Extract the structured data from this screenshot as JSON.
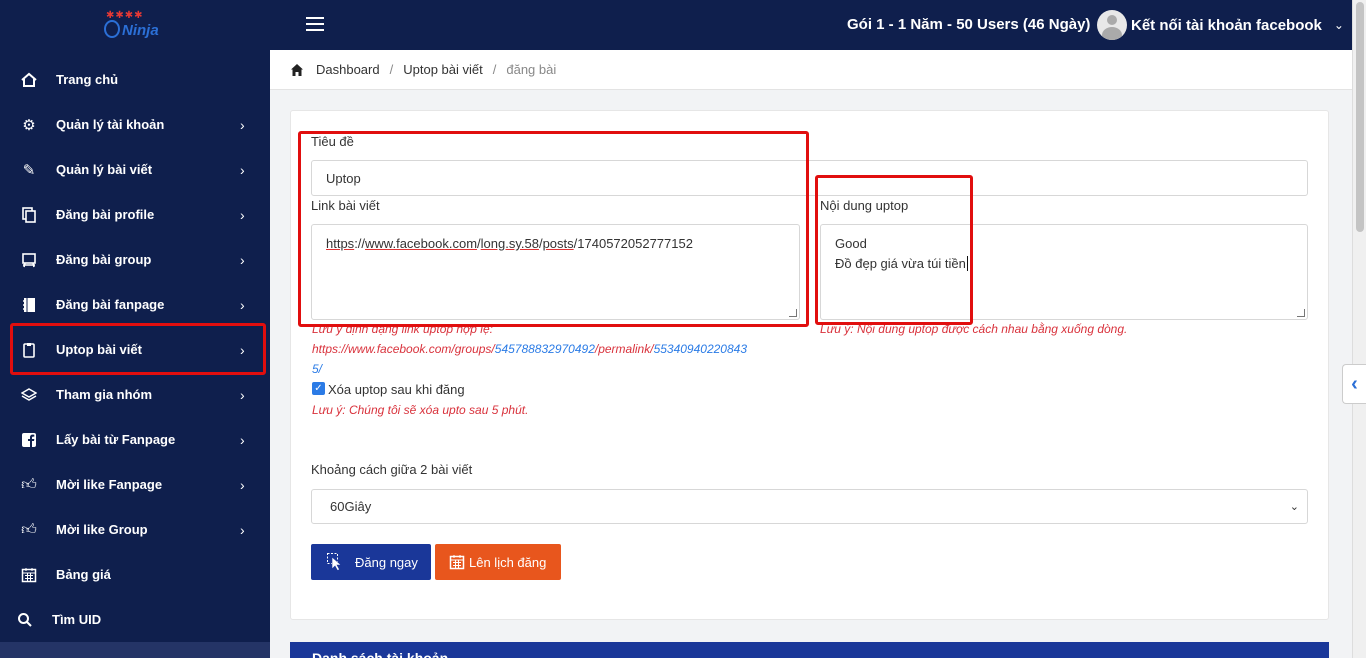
{
  "header": {
    "logo_text": "Ninja",
    "plan": "Gói 1 - 1 Năm - 50 Users (46 Ngày)",
    "user_label": "Kết nối tài khoản facebook"
  },
  "sidebar": {
    "items": [
      {
        "label": "Trang chủ",
        "icon": "home-icon"
      },
      {
        "label": "Quản lý tài khoản",
        "icon": "gear-icon"
      },
      {
        "label": "Quản lý bài viết",
        "icon": "pencil-icon"
      },
      {
        "label": "Đăng bài profile",
        "icon": "copy-icon"
      },
      {
        "label": "Đăng bài group",
        "icon": "board-icon"
      },
      {
        "label": "Đăng bài fanpage",
        "icon": "notebook-icon"
      },
      {
        "label": "Uptop bài viết",
        "icon": "clipboard-icon"
      },
      {
        "label": "Tham gia nhóm",
        "icon": "layers-icon"
      },
      {
        "label": "Lấy bài từ Fanpage",
        "icon": "facebook-icon"
      },
      {
        "label": "Mời like Fanpage",
        "icon": "thumbs-up-icon"
      },
      {
        "label": "Mời like Group",
        "icon": "thumbs-up-icon"
      },
      {
        "label": "Bảng giá",
        "icon": "calendar-icon"
      },
      {
        "label": "Tìm UID",
        "icon": "search-icon"
      }
    ]
  },
  "breadcrumb": {
    "items": [
      "Dashboard",
      "Uptop bài viết"
    ],
    "current": "đăng bài"
  },
  "form": {
    "title_label": "Tiêu đề",
    "title_value": "Uptop",
    "link_label": "Link bài viết",
    "link_parts": [
      "https",
      "://",
      "www.facebook.com",
      "/",
      "long.sy.58",
      "/",
      "posts",
      "/1740572052777152"
    ],
    "link_note_prefix": "Lưu ý định dạng link uptop hợp lệ:",
    "link_note_line1_base": "https://www.facebook.com/groups/",
    "link_note_line1_id": "545788832970492",
    "link_note_line1_mid": "/permalink/",
    "link_note_line1_tail": "55340940220843",
    "link_note_line2": "5/",
    "content_label": "Nội dung uptop",
    "content_lines": [
      "Good",
      "Đồ đẹp giá vừa túi tiền"
    ],
    "content_note": "Lưu ý: Nội dung uptop được cách nhau bằng xuống dòng.",
    "delete_checkbox_label": "Xóa uptop sau khi đăng",
    "delete_checked": true,
    "delete_note": "Lưu ý: Chúng tôi sẽ xóa upto sau 5 phút.",
    "interval_label": "Khoảng cách giữa 2 bài viết",
    "interval_value": "60Giây",
    "post_now_label": "Đăng ngay",
    "schedule_label": "Lên lịch đăng"
  },
  "bottom_panel": {
    "title": "Danh sách tài khoản"
  }
}
